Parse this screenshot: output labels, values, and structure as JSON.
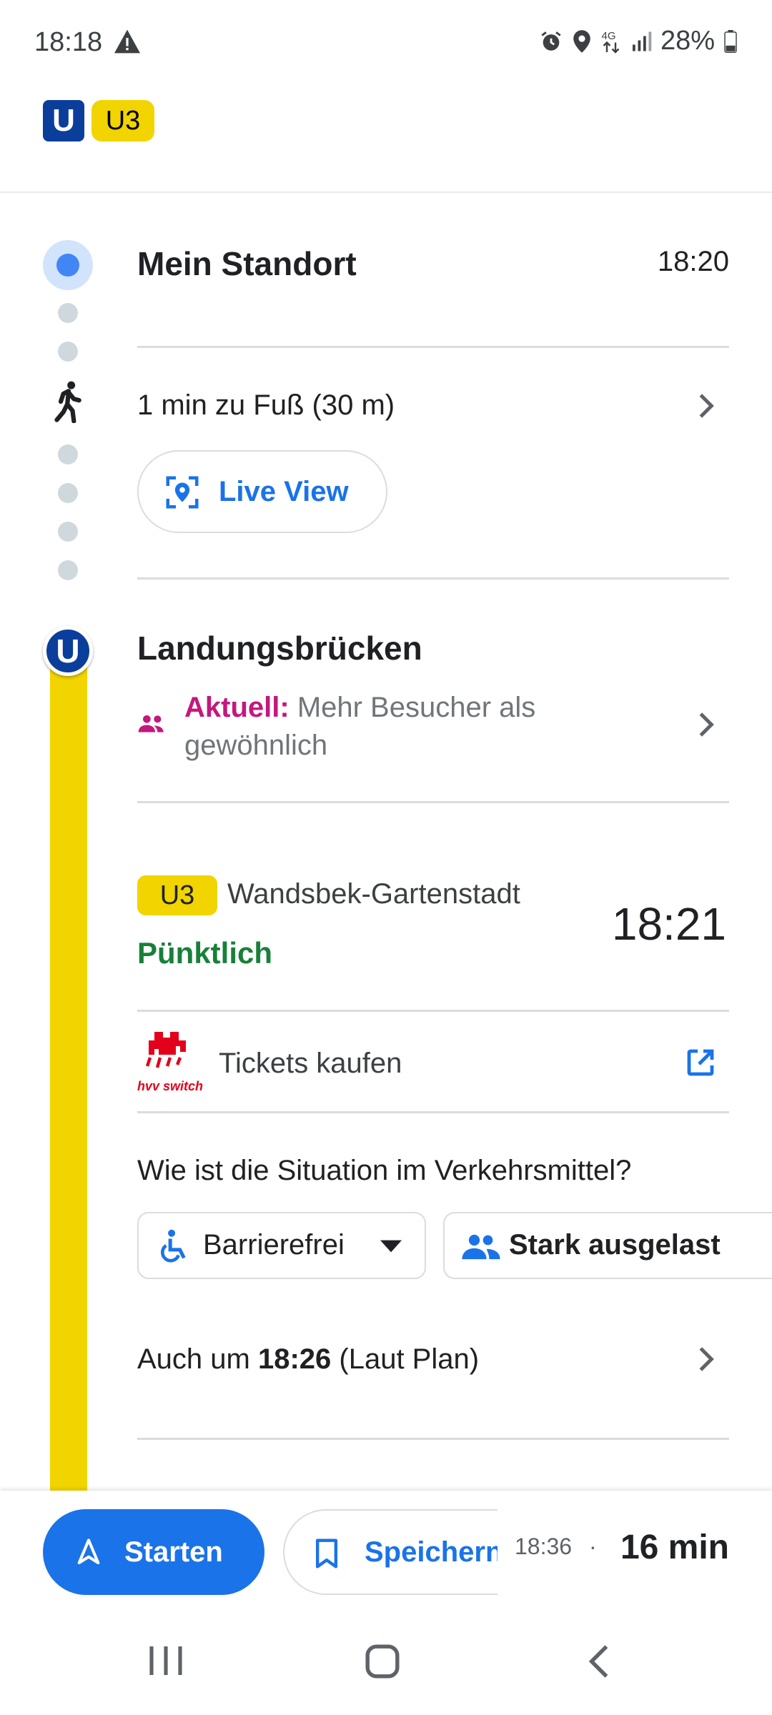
{
  "status_bar": {
    "time": "18:18",
    "battery": "28%"
  },
  "header": {
    "u_symbol": "U",
    "line": "U3"
  },
  "origin": {
    "name": "Mein Standort",
    "time": "18:20"
  },
  "walk": {
    "text": "1 min zu Fuß (30 m)",
    "live_view_label": "Live View"
  },
  "station": {
    "u_symbol": "U",
    "name": "Landungsbrücken",
    "crowd_prefix": "Aktuell:",
    "crowd_text": "Mehr Besucher als gewöhnlich"
  },
  "departure": {
    "line": "U3",
    "direction": "Wandsbek-Gartenstadt",
    "status": "Pünktlich",
    "time": "18:21",
    "status_color": "#188038"
  },
  "tickets": {
    "logo_text": "hvv switch",
    "label": "Tickets kaufen"
  },
  "situation": {
    "question": "Wie ist die Situation im Verkehrsmittel?",
    "chips": [
      "Barrierefrei",
      "Stark ausgelast"
    ]
  },
  "also": {
    "prefix": "Auch um ",
    "time": "18:26",
    "suffix": " (Laut Plan)"
  },
  "bottom": {
    "start_label": "Starten",
    "save_label": "Speichern",
    "arrival": "18:36",
    "separator": "·",
    "duration": "16 min"
  },
  "colors": {
    "accent": "#1a73e8",
    "u_blue": "#0b3e9b",
    "u3_yellow": "#f1d400",
    "crowd": "#c5177e"
  }
}
